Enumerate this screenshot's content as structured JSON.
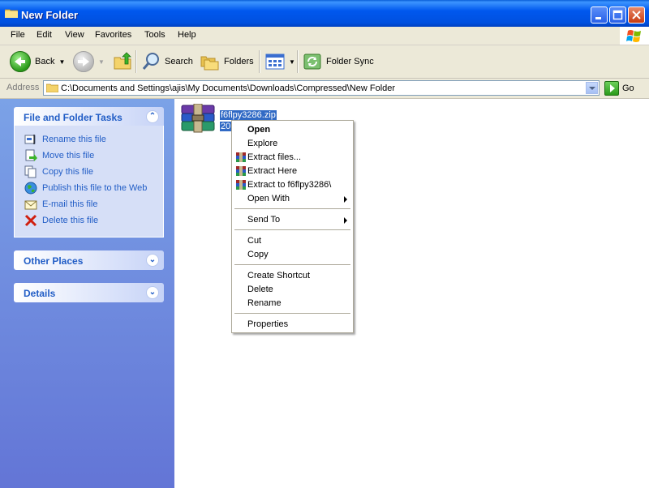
{
  "window": {
    "title": "New Folder",
    "colors": {
      "titlebar": "#0054e3",
      "taskpane": "#6375d6",
      "selection": "#316ac5",
      "link": "#215dc6"
    }
  },
  "menubar": {
    "items": [
      "File",
      "Edit",
      "View",
      "Favorites",
      "Tools",
      "Help"
    ]
  },
  "toolbar": {
    "back_label": "Back",
    "search_label": "Search",
    "folders_label": "Folders",
    "folder_sync_label": "Folder Sync"
  },
  "address": {
    "label": "Address",
    "path": "C:\\Documents and Settings\\ajis\\My Documents\\Downloads\\Compressed\\New Folder",
    "go_label": "Go"
  },
  "taskpane": {
    "file_folder_tasks": {
      "title": "File and Folder Tasks",
      "items": [
        {
          "label": "Rename this file",
          "icon": "rename-icon"
        },
        {
          "label": "Move this file",
          "icon": "move-icon"
        },
        {
          "label": "Copy this file",
          "icon": "copy-icon"
        },
        {
          "label": "Publish this file to the Web",
          "icon": "globe-icon"
        },
        {
          "label": "E-mail this file",
          "icon": "email-icon"
        },
        {
          "label": "Delete this file",
          "icon": "delete-icon"
        }
      ]
    },
    "other_places": {
      "title": "Other Places"
    },
    "details": {
      "title": "Details"
    }
  },
  "files": [
    {
      "name": "f6flpy3286.zip",
      "subline": "20",
      "icon": "winrar-archive-icon"
    }
  ],
  "context_menu": {
    "items": [
      {
        "label": "Open",
        "bold": true
      },
      {
        "label": "Explore"
      },
      {
        "label": "Extract files...",
        "icon": "winrar-icon"
      },
      {
        "label": "Extract Here",
        "icon": "winrar-icon"
      },
      {
        "label": "Extract to f6flpy3286\\",
        "icon": "winrar-icon"
      },
      {
        "label": "Open With",
        "submenu": true
      },
      {
        "label": "Send To",
        "submenu": true
      },
      {
        "label": "Cut"
      },
      {
        "label": "Copy"
      },
      {
        "label": "Create Shortcut"
      },
      {
        "label": "Delete"
      },
      {
        "label": "Rename"
      },
      {
        "label": "Properties"
      }
    ]
  }
}
